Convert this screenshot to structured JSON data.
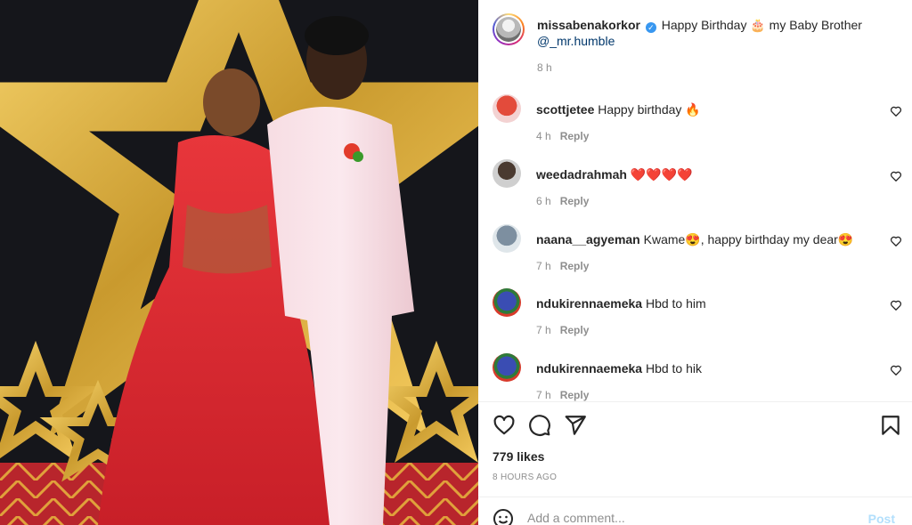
{
  "post": {
    "author": "missabenakorkor",
    "caption_text": "Happy Birthday 🎂 my Baby Brother",
    "caption_mention": "@_mr.humble",
    "time": "8 h"
  },
  "comments": [
    {
      "username": "scottjetee",
      "text": "Happy birthday 🔥",
      "time": "4 h",
      "reply": "Reply"
    },
    {
      "username": "weedadrahmah",
      "text": "❤️❤️❤️❤️",
      "time": "6 h",
      "reply": "Reply"
    },
    {
      "username": "naana__agyeman",
      "text": "Kwame😍, happy birthday my dear😍",
      "time": "7 h",
      "reply": "Reply"
    },
    {
      "username": "ndukirennaemeka",
      "text": "Hbd to him",
      "time": "7 h",
      "reply": "Reply"
    },
    {
      "username": "ndukirennaemeka",
      "text": "Hbd to hik",
      "time": "7 h",
      "reply": "Reply"
    }
  ],
  "likes": "779 likes",
  "post_age": "8 HOURS AGO",
  "add_comment": {
    "placeholder": "Add a comment...",
    "post_label": "Post"
  },
  "icons": {
    "like": "heart-icon",
    "comment": "comment-icon",
    "share": "share-icon",
    "save": "bookmark-icon",
    "emoji": "emoji-icon",
    "comment_like": "heart-icon"
  },
  "colors": {
    "text": "#262626",
    "muted": "#8e8e8e",
    "verified": "#3897f0",
    "mention": "#00376b",
    "post_disabled": "#b2dffc",
    "divider": "#efefef"
  }
}
